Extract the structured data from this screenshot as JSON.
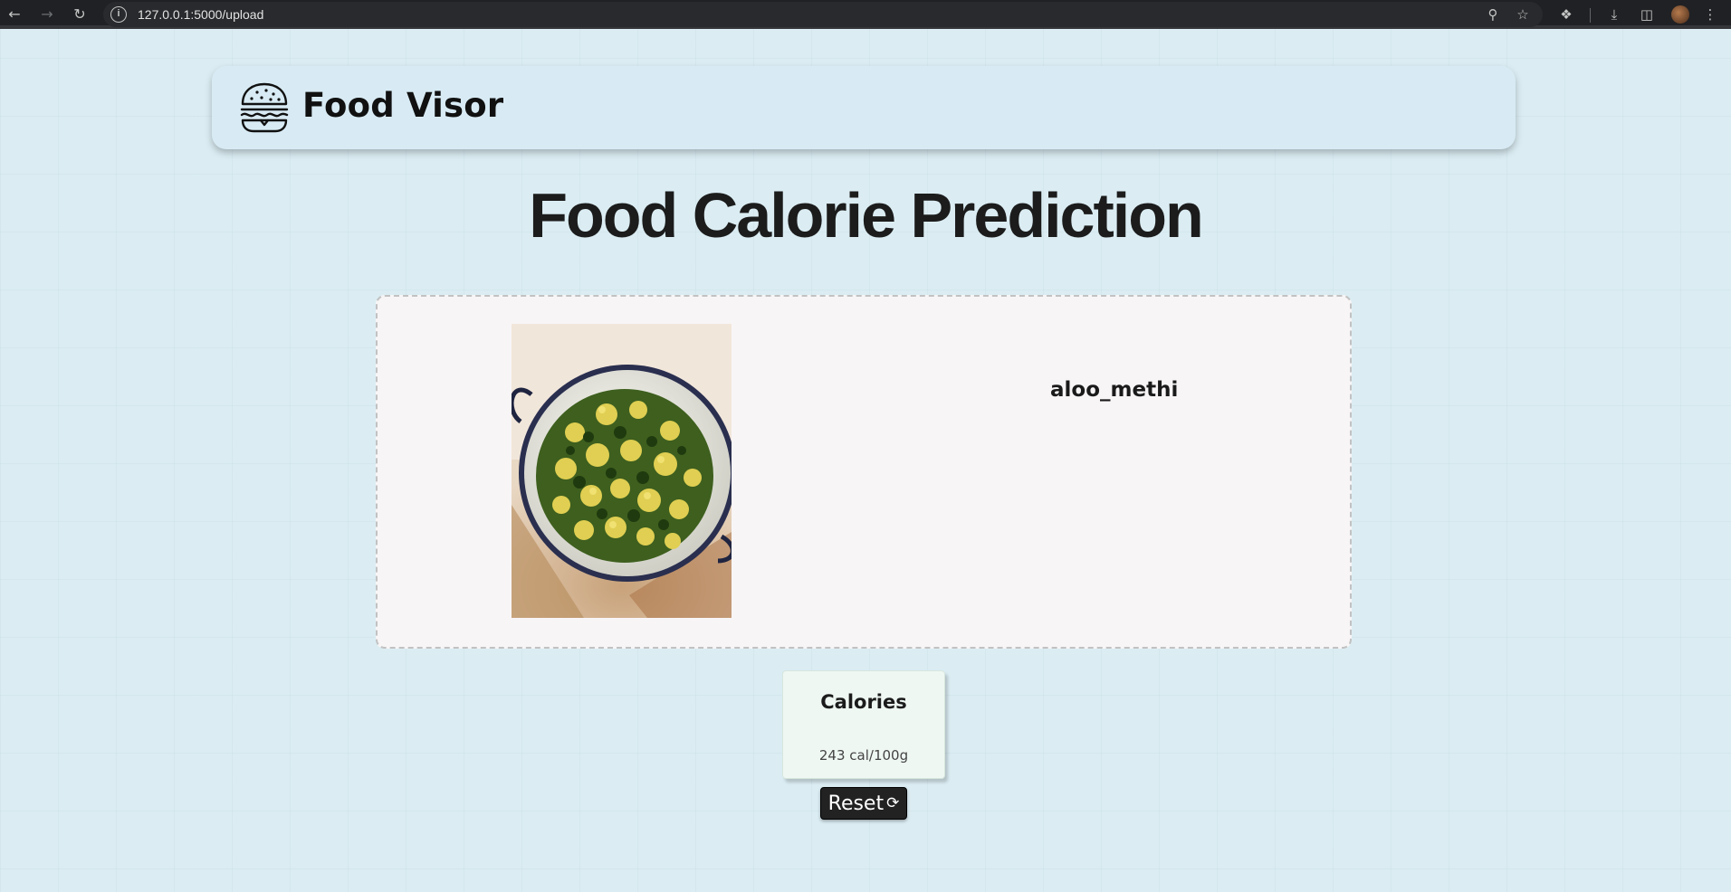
{
  "browser": {
    "url": "127.0.0.1:5000/upload",
    "icons": {
      "back": "back-arrow-icon",
      "forward": "forward-arrow-icon",
      "reload": "reload-icon",
      "site_info": "info-icon",
      "zoom": "zoom-icon",
      "bookmark": "star-icon",
      "extensions": "puzzle-icon",
      "downloads": "download-icon",
      "side_panel": "side-panel-icon",
      "menu": "kebab-menu-icon"
    }
  },
  "header": {
    "brand": "Food Visor",
    "logo_icon": "burger-icon"
  },
  "main": {
    "title": "Food Calorie Prediction",
    "prediction": {
      "food_name": "aloo_methi"
    },
    "calories": {
      "title": "Calories",
      "value": "243 cal/100g"
    },
    "reset_label": "Reset",
    "reset_icon": "reload-icon"
  },
  "colors": {
    "page_bg": "#dbedf3",
    "header_bg": "#d8ebf4",
    "panel_bg": "#f8f5f6",
    "card_bg": "#eef7f2",
    "button_bg": "#222222"
  }
}
